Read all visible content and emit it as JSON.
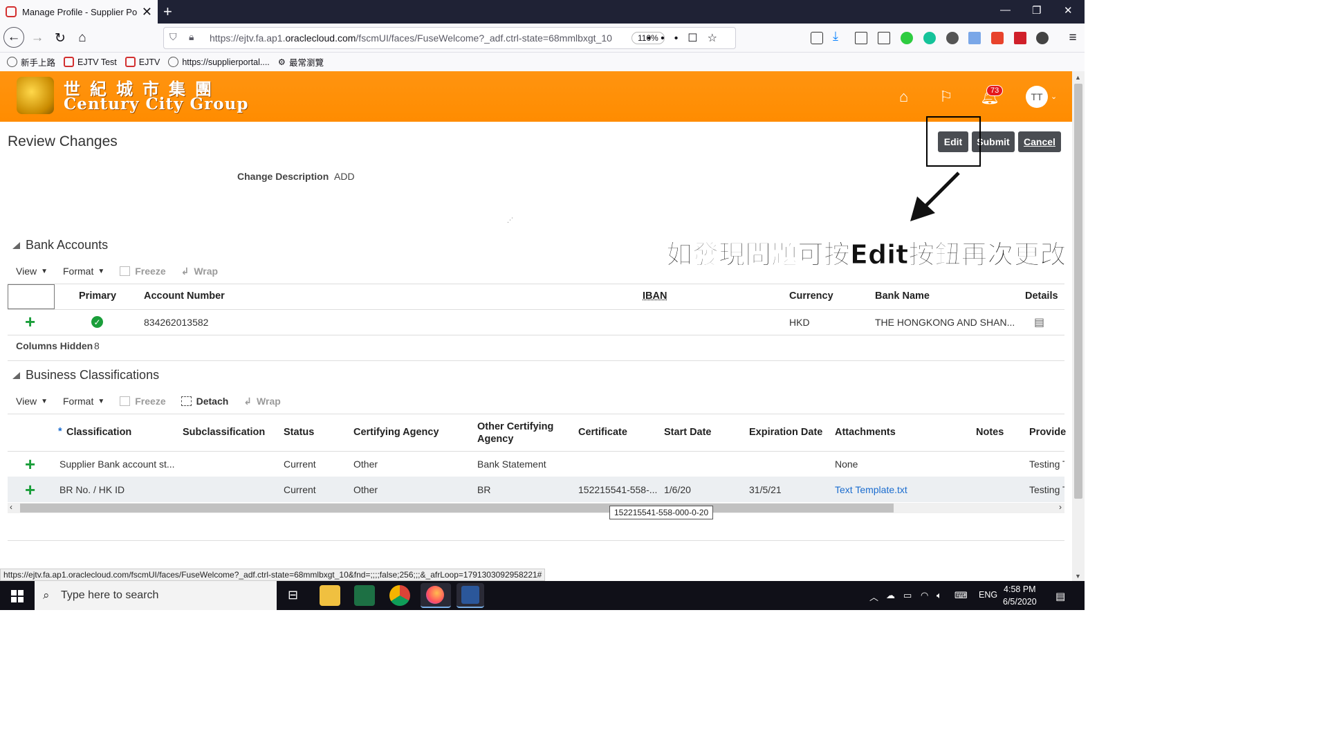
{
  "browser": {
    "tab_title": "Manage Profile - Supplier Porta",
    "url_prefix": "https://ejtv.fa.ap1.",
    "url_domain": "oraclecloud.com",
    "url_path": "/fscmUI/faces/FuseWelcome?_adf.ctrl-state=68mmlbxgt_10",
    "zoom": "110%",
    "bookmarks": [
      "新手上路",
      "EJTV Test",
      "EJTV",
      "https://supplierportal....",
      "最常瀏覽"
    ]
  },
  "header": {
    "logo_cn": "世紀城市集團",
    "logo_en": "Century City Group",
    "notification_count": "73",
    "avatar_initials": "TT"
  },
  "page": {
    "title": "Review Changes",
    "buttons": {
      "edit": "Edit",
      "submit": "Submit",
      "cancel": "Cancel"
    },
    "change_description_label": "Change Description",
    "change_description_value": "ADD",
    "annotation": "如發現問題可按Edit按鈕再次更改"
  },
  "bank_accounts": {
    "title": "Bank Accounts",
    "toolbar": {
      "view": "View",
      "format": "Format",
      "freeze": "Freeze",
      "wrap": "Wrap"
    },
    "columns": [
      "Primary",
      "Account Number",
      "IBAN",
      "Currency",
      "Bank Name",
      "Details"
    ],
    "rows": [
      {
        "account_number": "834262013582",
        "iban": "",
        "currency": "HKD",
        "bank_name": "THE HONGKONG AND SHAN..."
      }
    ],
    "columns_hidden_label": "Columns Hidden",
    "columns_hidden_count": "8"
  },
  "business_classifications": {
    "title": "Business Classifications",
    "toolbar": {
      "view": "View",
      "format": "Format",
      "freeze": "Freeze",
      "detach": "Detach",
      "wrap": "Wrap"
    },
    "columns": [
      "Classification",
      "Subclassification",
      "Status",
      "Certifying Agency",
      "Other Certifying Agency",
      "Certificate",
      "Start Date",
      "Expiration Date",
      "Attachments",
      "Notes",
      "Provide"
    ],
    "required_marker": "*",
    "rows": [
      {
        "classification": "Supplier Bank account st...",
        "subclassification": "",
        "status": "Current",
        "certifying_agency": "Other",
        "other_agency": "Bank Statement",
        "certificate": "",
        "start_date": "",
        "expiration_date": "",
        "attachments": "None",
        "notes": "",
        "provided_by": "Testing T"
      },
      {
        "classification": "BR No. / HK ID",
        "subclassification": "",
        "status": "Current",
        "certifying_agency": "Other",
        "other_agency": "BR",
        "certificate": "152215541-558-...",
        "start_date": "1/6/20",
        "expiration_date": "31/5/21",
        "attachments": "Text Template.txt",
        "notes": "",
        "provided_by": "Testing T"
      }
    ],
    "tooltip": "152215541-558-000-0-20"
  },
  "status_bar_url": "https://ejtv.fa.ap1.oraclecloud.com/fscmUI/faces/FuseWelcome?_adf.ctrl-state=68mmlbxgt_10&fnd=;;;;false;256;;;&_afrLoop=1791303092958221#",
  "taskbar": {
    "search_placeholder": "Type here to search",
    "language": "ENG",
    "time": "4:58 PM",
    "date": "6/5/2020"
  },
  "colors": {
    "header_orange": "#ff8c00",
    "button_dark": "#4a4d52",
    "add_green": "#1a9e3a",
    "link_blue": "#1a6ccf"
  }
}
